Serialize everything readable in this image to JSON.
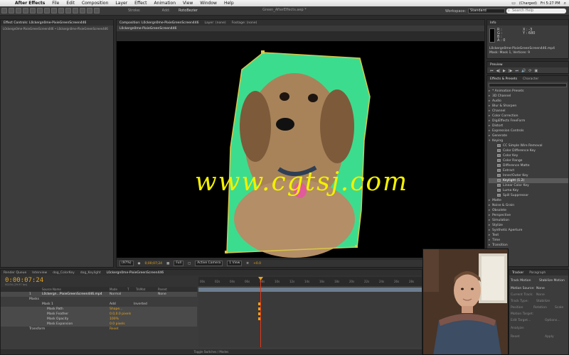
{
  "menubar": {
    "app_name": "After Effects",
    "items": [
      "File",
      "Edit",
      "Composition",
      "Layer",
      "Effect",
      "Animation",
      "View",
      "Window",
      "Help"
    ],
    "battery": "(Charged)",
    "clock": "Fri 5:27 PM"
  },
  "toolbar": {
    "document_title": "Green_AfterEffects.aep *",
    "stroke_label": "Stroke:",
    "add_label": "Add:",
    "roto_label": "RotoBezier",
    "workspace_label": "Workspace:",
    "workspace_value": "Standard",
    "search_placeholder": "Search Help"
  },
  "effect_controls": {
    "tab": "Effect Controls: L0ckergn0me-PixieGreenScreen446",
    "breadcrumb": "L0ckergn0me-PixieGreenScreen446 • L0ckergn0me-PixieGreenScreen446"
  },
  "composition": {
    "tab": "Composition: L0ckergn0me-PixieGreenScreen446",
    "layer_tab": "Layer: (none)",
    "footage_tab": "Footage: (none)",
    "sub_tab": "L0ckergn0me-PixieGreenScreen446",
    "zoom": "(97%)",
    "timecode": "0;00;07;24",
    "resolution": "Full",
    "camera": "Active Camera",
    "views": "1 View",
    "exposure": "+0.0",
    "watermark": "www.cgtsj.com",
    "colors": {
      "green_screen": "#3cdc8e",
      "mask_path": "#d8c64a",
      "watermark": "#f2f000"
    }
  },
  "info": {
    "tab": "Info",
    "r": "R :",
    "g": "G :",
    "b": "B :",
    "a": "A : 0",
    "x": "X : -3",
    "y": "Y : 680",
    "file": "L0ckergn0me-PixieGreenScreen446.mp4",
    "mask": "Mask: Mask 1, Vertices: 9"
  },
  "preview": {
    "tab": "Preview",
    "controls": [
      "⏮",
      "◀|",
      "▶",
      "|▶",
      "⏭",
      "🔊",
      "⟳",
      "▣"
    ]
  },
  "effects_presets": {
    "tab": "Effects & Presets",
    "tab2": "Character",
    "items": [
      {
        "label": "* Animation Presets",
        "child": false,
        "selected": false
      },
      {
        "label": "3D Channel",
        "child": false,
        "selected": false
      },
      {
        "label": "Audio",
        "child": false,
        "selected": false
      },
      {
        "label": "Blur & Sharpen",
        "child": false,
        "selected": false
      },
      {
        "label": "Channel",
        "child": false,
        "selected": false
      },
      {
        "label": "Color Correction",
        "child": false,
        "selected": false
      },
      {
        "label": "DigiEffects FreeForm",
        "child": false,
        "selected": false
      },
      {
        "label": "Distort",
        "child": false,
        "selected": false
      },
      {
        "label": "Expression Controls",
        "child": false,
        "selected": false
      },
      {
        "label": "Generate",
        "child": false,
        "selected": false
      },
      {
        "label": "Keying",
        "child": false,
        "selected": false,
        "open": true
      },
      {
        "label": "CC Simple Wire Removal",
        "child": true,
        "selected": false
      },
      {
        "label": "Color Difference Key",
        "child": true,
        "selected": false
      },
      {
        "label": "Color Key",
        "child": true,
        "selected": false
      },
      {
        "label": "Color Range",
        "child": true,
        "selected": false
      },
      {
        "label": "Difference Matte",
        "child": true,
        "selected": false
      },
      {
        "label": "Extract",
        "child": true,
        "selected": false
      },
      {
        "label": "Inner/Outer Key",
        "child": true,
        "selected": false
      },
      {
        "label": "Keylight (1.2)",
        "child": true,
        "selected": true
      },
      {
        "label": "Linear Color Key",
        "child": true,
        "selected": false
      },
      {
        "label": "Luma Key",
        "child": true,
        "selected": false
      },
      {
        "label": "Spill Suppressor",
        "child": true,
        "selected": false
      },
      {
        "label": "Matte",
        "child": false,
        "selected": false
      },
      {
        "label": "Noise & Grain",
        "child": false,
        "selected": false
      },
      {
        "label": "Obsolete",
        "child": false,
        "selected": false
      },
      {
        "label": "Perspective",
        "child": false,
        "selected": false
      },
      {
        "label": "Simulation",
        "child": false,
        "selected": false
      },
      {
        "label": "Stylize",
        "child": false,
        "selected": false
      },
      {
        "label": "Synthetic Aperture",
        "child": false,
        "selected": false
      },
      {
        "label": "Text",
        "child": false,
        "selected": false
      },
      {
        "label": "Time",
        "child": false,
        "selected": false
      },
      {
        "label": "Transition",
        "child": false,
        "selected": false
      }
    ]
  },
  "timeline": {
    "tabs": [
      "Render Queue",
      "Interview",
      "dog_ColorKey",
      "dog_Keylight",
      "L0ckergn0me-PixieGreenScreen446"
    ],
    "time": "0:00:07:24",
    "time_sub": "00234 (29.97 fps)",
    "col_source": "Source Name",
    "col_mode": "Mode",
    "col_t": "T",
    "col_trkmat": "TrkMat",
    "col_parent": "Parent",
    "layer_num": "1",
    "layer_name": "L0ckergn...PixieGreenScreen446.mp4",
    "layer_mode": "Normal",
    "parent_value": "None",
    "masks_label": "Masks",
    "mask1_label": "Mask 1",
    "mask1_mode": "Add",
    "mask1_inverted": "Inverted",
    "props": [
      {
        "label": "Mask Path",
        "value": "Shape..."
      },
      {
        "label": "Mask Feather",
        "value": "0.0,0.0 pixels"
      },
      {
        "label": "Mask Opacity",
        "value": "100%"
      },
      {
        "label": "Mask Expansion",
        "value": "0.0 pixels"
      }
    ],
    "transform_label": "Transform",
    "transform_value": "Reset",
    "ruler_ticks": [
      "00s",
      "02s",
      "04s",
      "06s",
      "08s",
      "10s",
      "12s",
      "14s",
      "16s",
      "18s",
      "20s",
      "22s",
      "24s",
      "26s",
      "28s"
    ],
    "footer": "Toggle Switches / Modes"
  },
  "tracker": {
    "tab": "Tracker",
    "tab2": "Paragraph",
    "track_motion": "Track Motion",
    "stabilize": "Stabilize Motion",
    "motion_source": "Motion Source:",
    "motion_source_value": "None",
    "current_track": "Current Track:",
    "current_track_value": "None",
    "track_type": "Track Type:",
    "track_type_value": "Stabilize",
    "position": "Position",
    "rotation": "Rotation",
    "scale": "Scale",
    "motion_target": "Motion Target:",
    "edit_target": "Edit Target...",
    "options": "Options...",
    "analyze": "Analyze:",
    "reset": "Reset",
    "apply": "Apply"
  }
}
